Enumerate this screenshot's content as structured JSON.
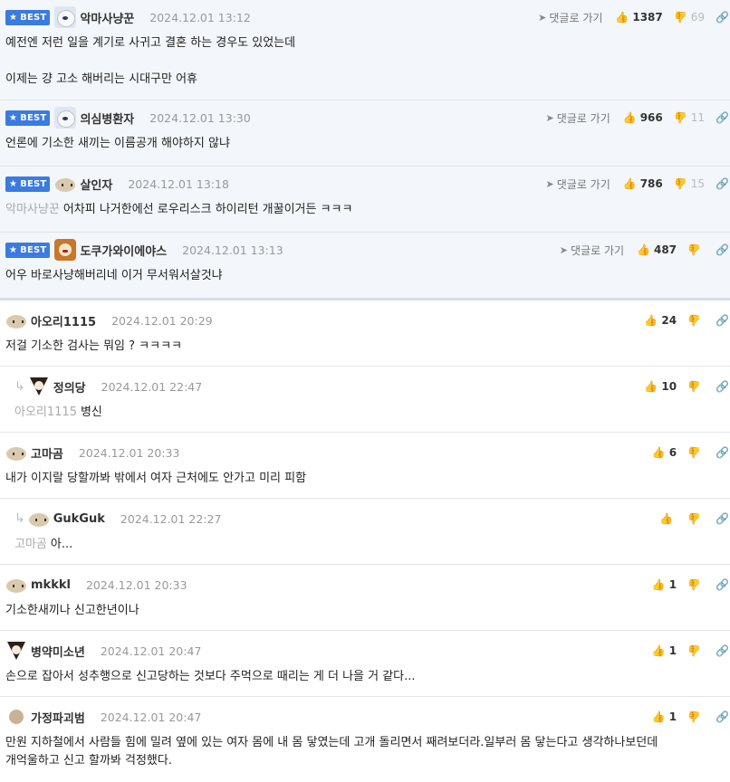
{
  "labels": {
    "best": "BEST",
    "go_reply": "댓글로 가기"
  },
  "best_comments": [
    {
      "nick": "악마사냥꾼",
      "date": "2024.12.01 13:12",
      "up": "1387",
      "down": "69",
      "mention": "",
      "text": "예전엔 저런 일을 계기로 사귀고 결혼 하는 경우도 있었는데\n\n이제는 걍 고소 해버리는 시대구만 어휴",
      "avatar": "bear-icon"
    },
    {
      "nick": "의심병환자",
      "date": "2024.12.01 13:30",
      "up": "966",
      "down": "11",
      "mention": "",
      "text": "언론에 기소한 새끼는 이름공개 해야하지 않냐",
      "avatar": "bear-icon"
    },
    {
      "nick": "살인자",
      "date": "2024.12.01 13:18",
      "up": "786",
      "down": "15",
      "mention": "악마사냥꾼",
      "text": "어차피 나거한에선 로우리스크 하이리턴 개꿀이거든 ㅋㅋㅋ",
      "avatar": "dog-icon"
    },
    {
      "nick": "도쿠가와이에야스",
      "date": "2024.12.01 13:13",
      "up": "487",
      "down": "",
      "mention": "",
      "text": "어우 바로사냥해버리네 이거 무서워서살것냐",
      "avatar": "lion-icon"
    }
  ],
  "comments": [
    {
      "nick": "아오리1115",
      "date": "2024.12.01 20:29",
      "up": "24",
      "mention": "",
      "text": "저걸 기소한 검사는 뭐임 ? ㅋㅋㅋㅋ",
      "reply": false,
      "avatar": "dog-icon"
    },
    {
      "nick": "정의당",
      "date": "2024.12.01 22:47",
      "up": "10",
      "mention": "아오리1115",
      "text": "병신",
      "reply": true,
      "avatar": "fox-icon"
    },
    {
      "nick": "고마곰",
      "date": "2024.12.01 20:33",
      "up": "6",
      "mention": "",
      "text": "내가 이지랄 당할까봐 밖에서 여자 근처에도 안가고 미리 피함",
      "reply": false,
      "avatar": "dog-icon"
    },
    {
      "nick": "GukGuk",
      "date": "2024.12.01 22:27",
      "up": "",
      "mention": "고마곰",
      "text": "아...",
      "reply": true,
      "avatar": "dog-icon"
    },
    {
      "nick": "mkkkl",
      "date": "2024.12.01 20:33",
      "up": "1",
      "mention": "",
      "text": "기소한새끼나 신고한년이나",
      "reply": false,
      "avatar": "dog-icon"
    },
    {
      "nick": "병약미소년",
      "date": "2024.12.01 20:47",
      "up": "1",
      "mention": "",
      "text": "손으로 잡아서 성추행으로 신고당하는 것보다 주먹으로 때리는 게 더 나을 거 같다...",
      "reply": false,
      "avatar": "fox-icon"
    },
    {
      "nick": "가정파괴범",
      "date": "2024.12.01 20:47",
      "up": "1",
      "mention": "",
      "text": "만원 지하철에서 사람들 힘에 밀려 옆에 있는 여자 몸에 내 몸 닿였는데 고개 돌리면서 째려보더라.일부러 몸 닿는다고 생각하나보던데\n개억울하고 신고 할까봐 걱정했다.",
      "reply": false,
      "avatar": "ball-icon"
    }
  ]
}
